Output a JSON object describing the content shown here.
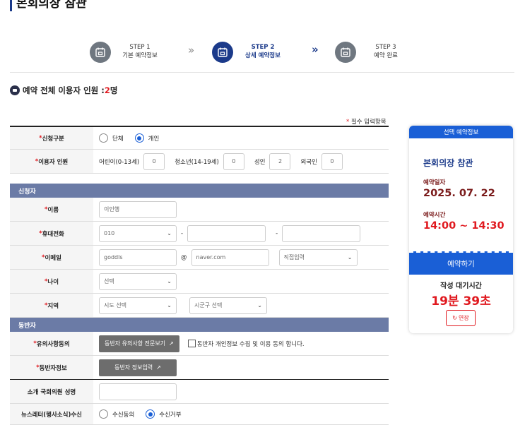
{
  "page_title": "본회의장 참관",
  "steps": [
    {
      "num": "STEP 1",
      "label": "기본 예약정보"
    },
    {
      "num": "STEP 2",
      "label": "상세 예약정보"
    },
    {
      "num": "STEP 3",
      "label": "예약 완료"
    }
  ],
  "step_separator": "»",
  "total_users": {
    "label": "예약 전체 이용자 인원 : ",
    "count": "2",
    "unit": "명"
  },
  "required_note": {
    "star": "*",
    "text": " 필수 입력항목"
  },
  "form": {
    "apply_type": {
      "star": "* ",
      "label": "신청구분",
      "options": [
        "단체",
        "개인"
      ],
      "selected": "개인"
    },
    "users": {
      "star": "* ",
      "label": "이용자 인원",
      "groups": [
        {
          "label": "어린이(0-13세)",
          "value": "0"
        },
        {
          "label": "청소년(14-19세)",
          "value": "0"
        },
        {
          "label": "성인",
          "value": "2"
        },
        {
          "label": "외국인",
          "value": "0"
        }
      ]
    },
    "applicant_section": "신청자",
    "name": {
      "star": "* ",
      "label": "이름",
      "value": "이인행"
    },
    "phone": {
      "star": "* ",
      "label": "휴대전화",
      "prefix": "010",
      "dash": "-",
      "mid": "",
      "last": ""
    },
    "email": {
      "star": "* ",
      "label": "이메일",
      "id": "goddls",
      "at": "@",
      "domain": "naver.com",
      "direct": "직접입력"
    },
    "age": {
      "star": "* ",
      "label": "나이",
      "value": "선택"
    },
    "region": {
      "star": "* ",
      "label": "지역",
      "sido": "시도 선택",
      "sigungu": "시군구 선택"
    },
    "companion_section": "동반자",
    "notice": {
      "star": "* ",
      "label": "유의사항동의",
      "button": "동반자 유의사항 전문보기",
      "consent": "동반자 개인정보 수집 및 이용 동의 합니다."
    },
    "companion_info": {
      "star": "* ",
      "label": "동반자정보",
      "button": "동반자 정보입력"
    },
    "intro_member": {
      "label": "소개 국회의원 성명",
      "value": ""
    },
    "newsletter": {
      "label": "뉴스레터(행사소식)수신",
      "options": [
        "수신동의",
        "수신거부"
      ],
      "selected": "수신거부"
    }
  },
  "sidebar": {
    "header": "선택 예약정보",
    "program": "본회의장 참관",
    "date_label": "예약일자",
    "date": "2025. 07. 22",
    "time_label": "예약시간",
    "time": "14:00 ~ 14:30",
    "reserve_button": "예약하기",
    "wait_label": "작성 대기시간",
    "timer": "19분 39초",
    "extend_button": "연장"
  },
  "colors": {
    "primary": "#1a5fd6",
    "navy": "#1b3a8a",
    "section": "#6b7ba6",
    "accent_red": "#e0191f"
  }
}
